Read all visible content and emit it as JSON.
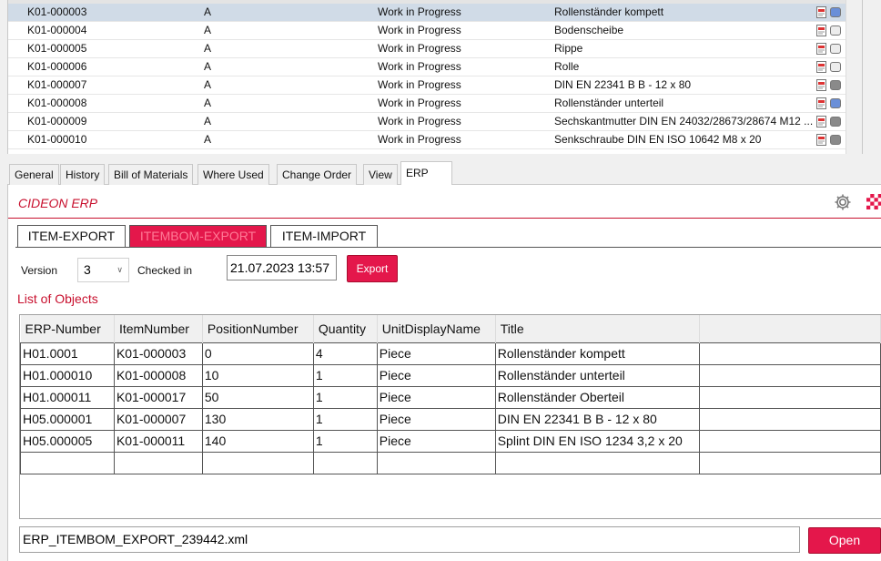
{
  "item_list": {
    "rows": [
      {
        "item": "K01-000003",
        "rev": "A",
        "status": "Work in Progress",
        "description": "Rollenständer kompett",
        "icon1": "pdf-doc-icon",
        "icon2": "blue-square-icon",
        "icon2_color": "#6a8fd8",
        "selected": true
      },
      {
        "item": "K01-000004",
        "rev": "A",
        "status": "Work in Progress",
        "description": "Bodenscheibe",
        "icon1": "pdf-doc-icon",
        "icon2": "white-square-icon",
        "icon2_color": "#ececec",
        "selected": false
      },
      {
        "item": "K01-000005",
        "rev": "A",
        "status": "Work in Progress",
        "description": "Rippe",
        "icon1": "pdf-doc-icon",
        "icon2": "white-square-icon",
        "icon2_color": "#ececec",
        "selected": false
      },
      {
        "item": "K01-000006",
        "rev": "A",
        "status": "Work in Progress",
        "description": "Rolle",
        "icon1": "pdf-doc-icon",
        "icon2": "white-square-icon",
        "icon2_color": "#ececec",
        "selected": false
      },
      {
        "item": "K01-000007",
        "rev": "A",
        "status": "Work in Progress",
        "description": "DIN EN 22341 B B - 12 x 80",
        "icon1": "pdf-doc-icon",
        "icon2": "gray-square-icon",
        "icon2_color": "#8a8a8a",
        "selected": false
      },
      {
        "item": "K01-000008",
        "rev": "A",
        "status": "Work in Progress",
        "description": "Rollenständer unterteil",
        "icon1": "pdf-doc-icon",
        "icon2": "blue-square-icon",
        "icon2_color": "#6a8fd8",
        "selected": false
      },
      {
        "item": "K01-000009",
        "rev": "A",
        "status": "Work in Progress",
        "description": "Sechskantmutter DIN EN 24032/28673/28674 M12 ...",
        "icon1": "pdf-doc-icon",
        "icon2": "gray-square-icon",
        "icon2_color": "#8a8a8a",
        "selected": false
      },
      {
        "item": "K01-000010",
        "rev": "A",
        "status": "Work in Progress",
        "description": "Senkschraube DIN EN ISO 10642 M8  x  20",
        "icon1": "pdf-doc-icon",
        "icon2": "gray-square-icon",
        "icon2_color": "#8a8a8a",
        "selected": false
      }
    ]
  },
  "tabs": {
    "general": "General",
    "history": "History",
    "bom": "Bill of Materials",
    "where_used": "Where Used",
    "change_order": "Change Order",
    "view": "View",
    "erp": "ERP",
    "active": "erp"
  },
  "erp": {
    "brand": "CIDEON ERP",
    "brand_color": "#c8102e",
    "accent_color": "#e4174b",
    "subtabs": {
      "item_export": "ITEM-EXPORT",
      "itembom_export": "ITEMBOM-EXPORT",
      "item_import": "ITEM-IMPORT",
      "active": "itembom_export"
    },
    "version_label": "Version",
    "version_value": "3",
    "checked_in_label": "Checked in",
    "checked_in_value": "21.07.2023 13:57",
    "export_button": "Export",
    "list_title": "List of Objects",
    "columns": [
      "ERP-Number",
      "ItemNumber",
      "PositionNumber",
      "Quantity",
      "UnitDisplayName",
      "Title"
    ],
    "rows": [
      [
        "H01.0001",
        "K01-000003",
        "0",
        "4",
        "Piece",
        "Rollenständer kompett"
      ],
      [
        "H01.000010",
        "K01-000008",
        "10",
        "1",
        "Piece",
        "Rollenständer unterteil"
      ],
      [
        "H01.000011",
        "K01-000017",
        "50",
        "1",
        "Piece",
        "Rollenständer Oberteil"
      ],
      [
        "H05.000001",
        "K01-000007",
        "130",
        "1",
        "Piece",
        "DIN EN 22341 B B - 12 x 80"
      ],
      [
        "H05.000005",
        "K01-000011",
        "140",
        "1",
        "Piece",
        "Splint DIN EN ISO 1234 3,2 x 20"
      ]
    ],
    "file_name": "ERP_ITEMBOM_EXPORT_239442.xml",
    "open_button": "Open"
  }
}
